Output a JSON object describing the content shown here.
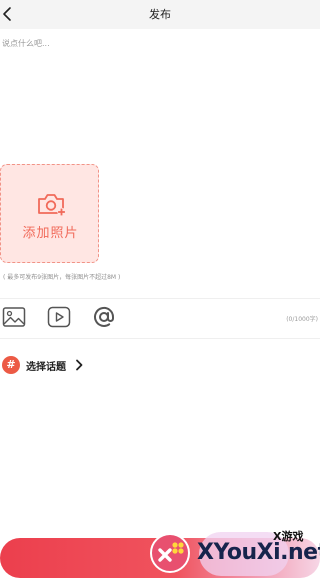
{
  "header": {
    "title": "发布"
  },
  "composer": {
    "placeholder": "说点什么吧..."
  },
  "upload": {
    "label": "添加照片",
    "hint": "( 最多可发布9张图片，每张图片不超过8M )"
  },
  "toolbar": {
    "icons": [
      "image-icon",
      "video-icon",
      "at-icon"
    ],
    "char_count": "(0/1000字)"
  },
  "topic": {
    "label": "选择话题"
  },
  "watermark": {
    "line1": "X游戏",
    "line2": "XYouXi.net"
  },
  "colors": {
    "accent": "#f16a5a",
    "upload_bg": "#ffe6e3",
    "publish_bar": "#ec3f4d",
    "topic_icon": "#ec5a45"
  }
}
